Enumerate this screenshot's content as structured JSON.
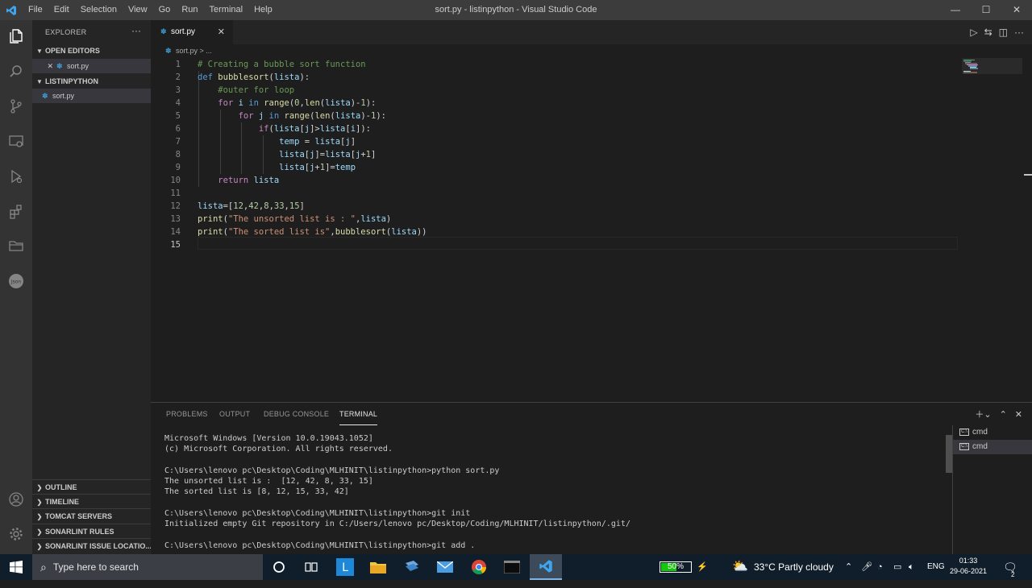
{
  "titlebar": {
    "menu": [
      "File",
      "Edit",
      "Selection",
      "View",
      "Go",
      "Run",
      "Terminal",
      "Help"
    ],
    "title": "sort.py - listinpython - Visual Studio Code",
    "min": "—",
    "max": "☐",
    "close": "✕"
  },
  "sidebar": {
    "title": "EXPLORER",
    "more": "···",
    "open_editors": "OPEN EDITORS",
    "open_file": "sort.py",
    "folder": "LISTINPYTHON",
    "file": "sort.py",
    "sections": [
      "OUTLINE",
      "TIMELINE",
      "TOMCAT SERVERS",
      "SONARLINT RULES",
      "SONARLINT ISSUE LOCATIO..."
    ]
  },
  "editor": {
    "tab_label": "sort.py",
    "breadcrumb": "sort.py > ...",
    "lines": [
      "# Creating a bubble sort function",
      "def bubblesort(lista):",
      "    #outer for loop",
      "    for i in range(0,len(lista)-1):",
      "        for j in range(len(lista)-1):",
      "            if(lista[j]>lista[i]):",
      "                temp = lista[j]",
      "                lista[j]=lista[j+1]",
      "                lista[j+1]=temp",
      "    return lista",
      "",
      "lista=[12,42,8,33,15]",
      "print(\"The unsorted list is : \",lista)",
      "print(\"The sorted list is\",bubblesort(lista))",
      ""
    ],
    "line_numbers": [
      "1",
      "2",
      "3",
      "4",
      "5",
      "6",
      "7",
      "8",
      "9",
      "10",
      "11",
      "12",
      "13",
      "14",
      "15"
    ]
  },
  "panel": {
    "tabs": [
      "PROBLEMS",
      "OUTPUT",
      "DEBUG CONSOLE",
      "TERMINAL"
    ],
    "terminal_lines": [
      "Microsoft Windows [Version 10.0.19043.1052]",
      "(c) Microsoft Corporation. All rights reserved.",
      "",
      "C:\\Users\\lenovo pc\\Desktop\\Coding\\MLHINIT\\listinpython>python sort.py",
      "The unsorted list is :  [12, 42, 8, 33, 15]",
      "The sorted list is [8, 12, 15, 33, 42]",
      "",
      "C:\\Users\\lenovo pc\\Desktop\\Coding\\MLHINIT\\listinpython>git init",
      "Initialized empty Git repository in C:/Users/lenovo pc/Desktop/Coding/MLHINIT/listinpython/.git/",
      "",
      "C:\\Users\\lenovo pc\\Desktop\\Coding\\MLHINIT\\listinpython>git add ."
    ],
    "terminals": [
      "cmd",
      "cmd"
    ]
  },
  "taskbar": {
    "search_placeholder": "Type here to search",
    "battery": "50%",
    "weather": "33°C  Partly cloudy",
    "lang": "ENG",
    "time": "01:33",
    "date": "29-06-2021",
    "notif_count": "2"
  },
  "colors": {
    "accent": "#007acc",
    "python_icon": "#3e9fd6",
    "battery_fill": "#16c60c"
  }
}
